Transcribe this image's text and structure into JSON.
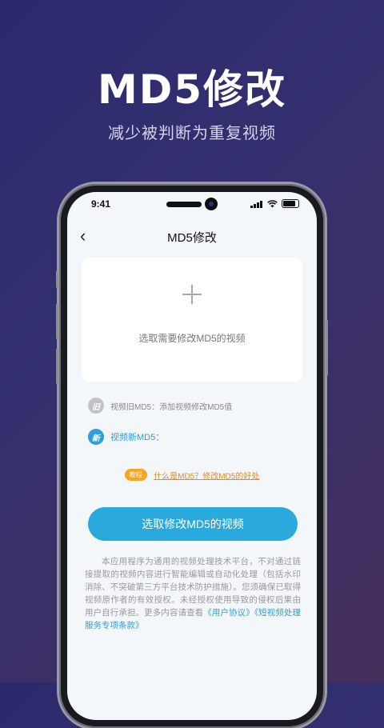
{
  "hero": {
    "title": "MD5修改",
    "subtitle": "减少被判断为重复视频"
  },
  "status_bar": {
    "time": "9:41"
  },
  "nav": {
    "back_icon": "chevron-left-icon",
    "title": "MD5修改"
  },
  "upload": {
    "icon": "plus-icon",
    "label": "选取需要修改MD5的视频"
  },
  "old_md5": {
    "badge": "旧",
    "text": "视频旧MD5：添加视频修改MD5值"
  },
  "new_md5": {
    "badge": "新",
    "text": "视频新MD5："
  },
  "tutorial": {
    "tag": "教程",
    "link": "什么是MD5？修改MD5的好处"
  },
  "primary_button": {
    "label": "选取修改MD5的视频"
  },
  "disclaimer": {
    "text": "本应用程序为通用的视频处理技术平台，不对通过链接提取的视频内容进行智能编辑或自动化处理（包括水印消除、不突破第三方平台技术防护措施）。您须确保已取得视频原作者的有效授权。未经授权使用导致的侵权后果由用户自行承担。更多内容请查看",
    "link_user_agreement": "《用户协议》",
    "link_service_terms": "《短视频处理服务专项条款》"
  },
  "colors": {
    "accent": "#2aa9dc",
    "tutorial_tag": "#f5a623",
    "background_start": "#2b2a6e",
    "background_end": "#442f5c"
  }
}
